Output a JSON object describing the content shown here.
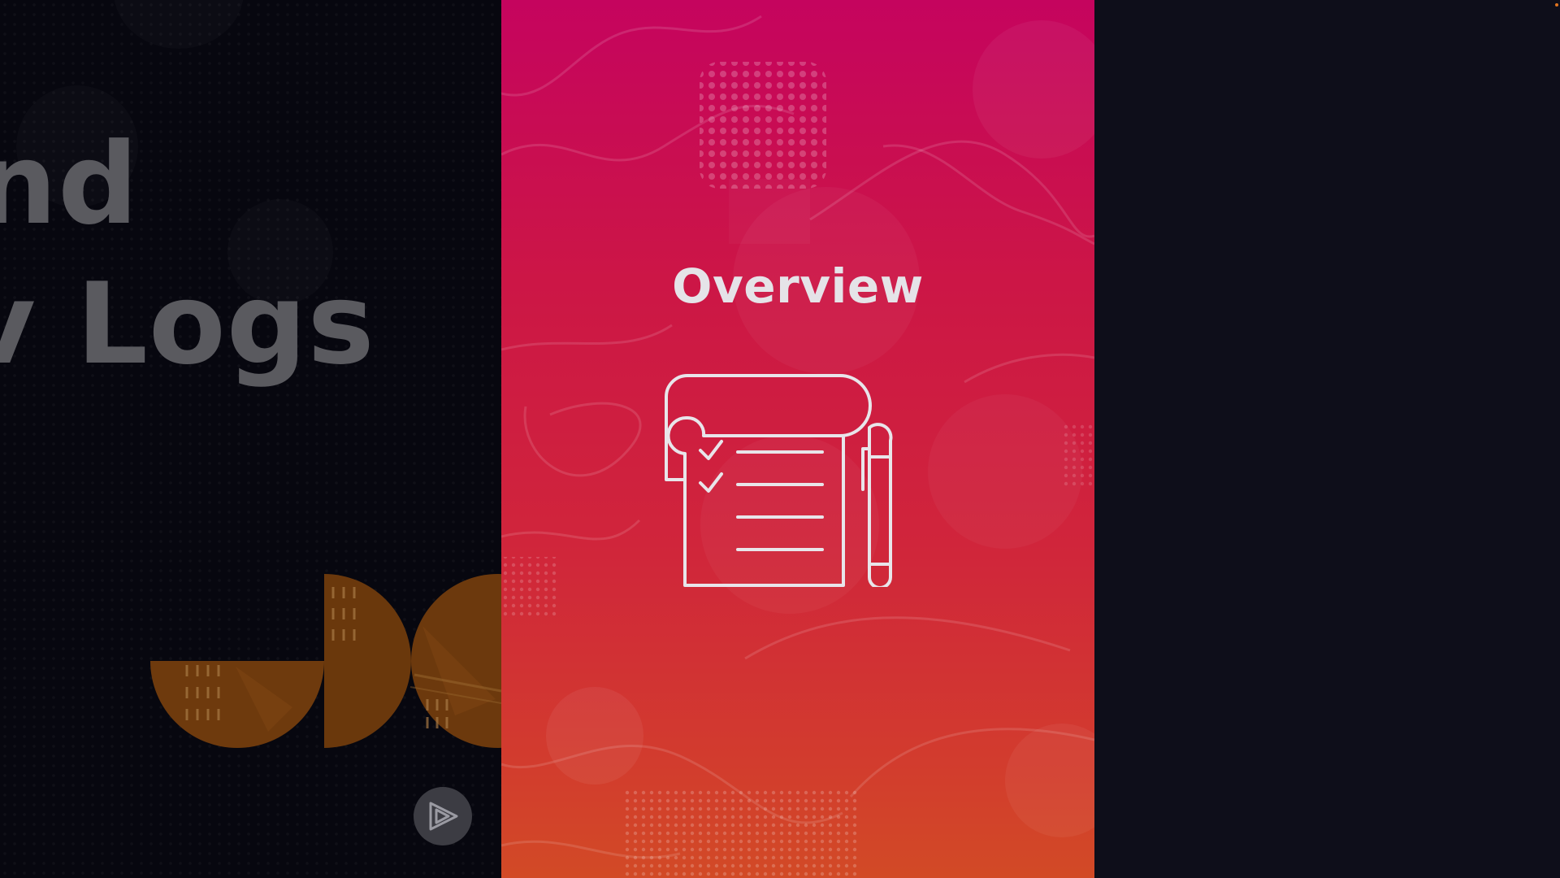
{
  "left_slide": {
    "title_line_1": "nd",
    "title_line_2": "v Logs",
    "play_icon": "play-logo-icon"
  },
  "center_card": {
    "title": "Overview",
    "icon": "notepad-checklist-pen-icon"
  },
  "colors": {
    "card_gradient_top": "#c5045e",
    "card_gradient_bottom": "#d24a26",
    "background": "#0e0e1a",
    "title_text": "#e5e3e8",
    "dim_title_text": "#5a5a5f",
    "accent_orange": "#8a4a12"
  }
}
